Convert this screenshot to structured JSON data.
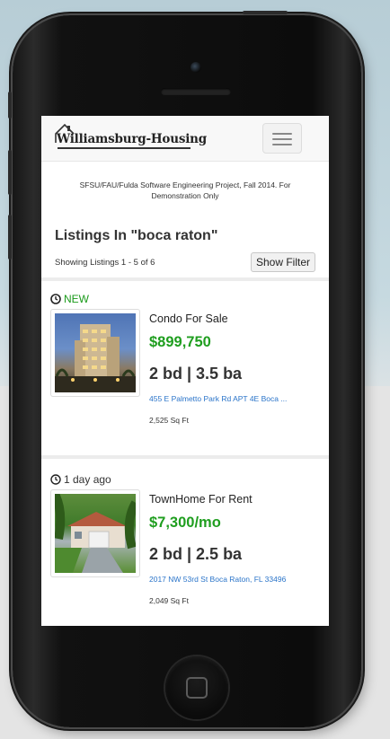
{
  "header": {
    "logo_text": "Williamsburg-Housing"
  },
  "disclaimer": "SFSU/FAU/Fulda Software Engineering Project, Fall 2014. For Demonstration Only",
  "results": {
    "title": "Listings In \"boca raton\"",
    "showing_text": "Showing Listings 1 - 5 of 6",
    "filter_button_label": "Show Filter"
  },
  "listings": [
    {
      "age": "NEW",
      "type": "Condo For Sale",
      "price": "$899,750",
      "rooms": "2 bd | 3.5 ba",
      "address": "455 E Palmetto Park Rd APT 4E Boca ...",
      "sqft": "2,525 Sq Ft"
    },
    {
      "age": "1 day ago",
      "type": "TownHome For Rent",
      "price": "$7,300/mo",
      "rooms": "2 bd | 2.5 ba",
      "address": "2017 NW 53rd St Boca Raton, FL 33496",
      "sqft": "2,049 Sq Ft"
    }
  ],
  "colors": {
    "price_green": "#1f9e1f",
    "new_badge_green": "#1a9a1a",
    "link_blue": "#2a74c9"
  },
  "icons": {
    "clock": "clock-icon",
    "menu": "hamburger-menu-icon",
    "home_button": "home-button-icon"
  }
}
